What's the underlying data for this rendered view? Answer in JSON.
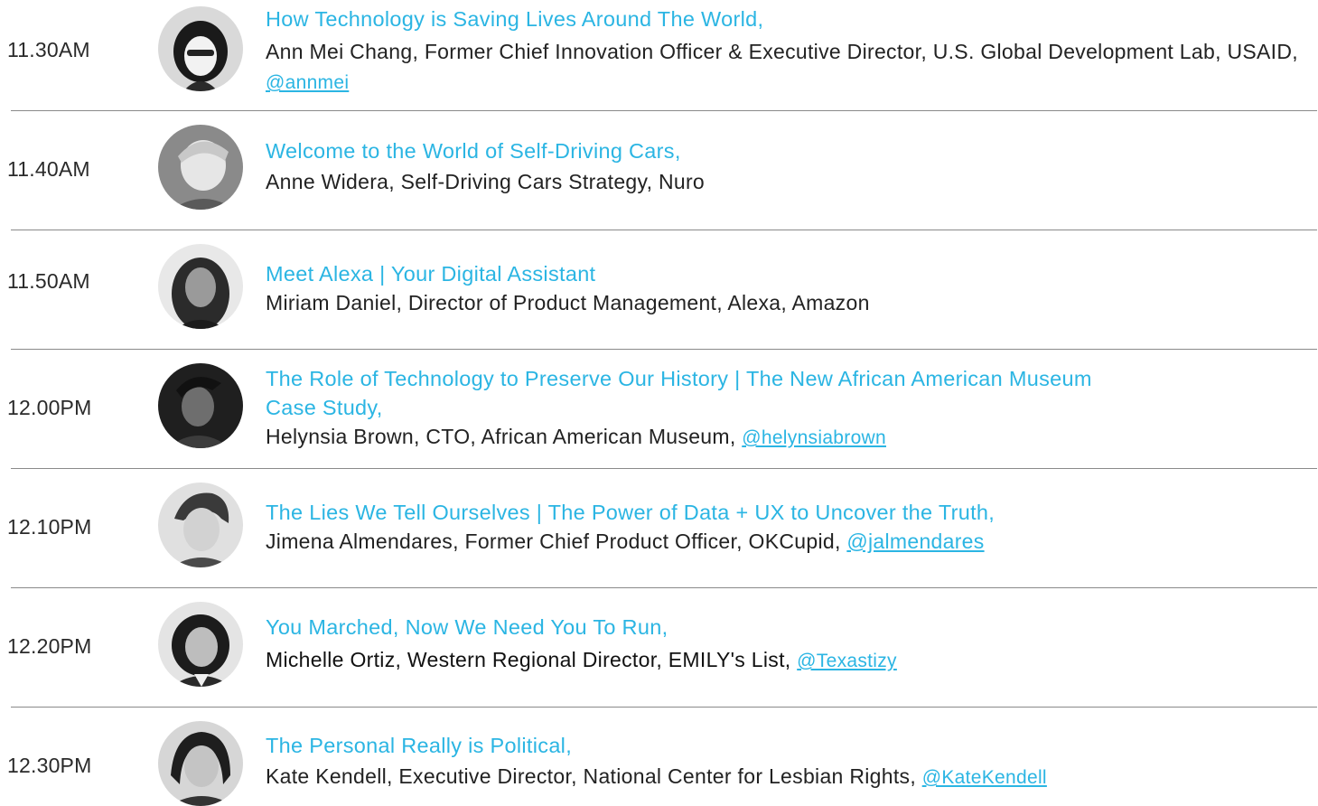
{
  "accent_color": "#2bb5e3",
  "sessions": [
    {
      "time": "11.30AM",
      "title": "How Technology is Saving Lives Around The World,",
      "speaker": "Ann Mei Chang, Former Chief Innovation Officer & Executive Director, U.S. Global Development Lab, USAID, ",
      "handle": "@annmei"
    },
    {
      "time": "11.40AM",
      "title": "Welcome to the World of Self-Driving Cars,",
      "speaker": " Anne Widera, Self-Driving Cars Strategy, Nuro",
      "handle": ""
    },
    {
      "time": "11.50AM",
      "title": "Meet Alexa  |  Your Digital Assistant",
      "speaker": "Miriam Daniel, Director of Product Management, Alexa, Amazon",
      "handle": ""
    },
    {
      "time": "12.00PM",
      "title": "The Role of Technology to Preserve Our History | The New African American Museum Case Study,",
      "speaker": "Helynsia Brown, CTO, African American Museum, ",
      "handle": "@helynsiabrown"
    },
    {
      "time": "12.10PM",
      "title": "The Lies We Tell Ourselves  |  The Power of Data + UX to Uncover the Truth,",
      "speaker": "Jimena Almendares, Former Chief Product Officer, OKCupid, ",
      "handle": "@jalmendares"
    },
    {
      "time": "12.20PM",
      "title": "You Marched, Now We Need You To Run,",
      "speaker": "Michelle Ortiz, Western Regional Director, EMILY's List, ",
      "handle": "@Texastizy"
    },
    {
      "time": "12.30PM",
      "title": "The Personal Really is Political,",
      "speaker": "Kate Kendell, Executive Director, National Center for Lesbian Rights, ",
      "handle": "@KateKendell"
    }
  ]
}
